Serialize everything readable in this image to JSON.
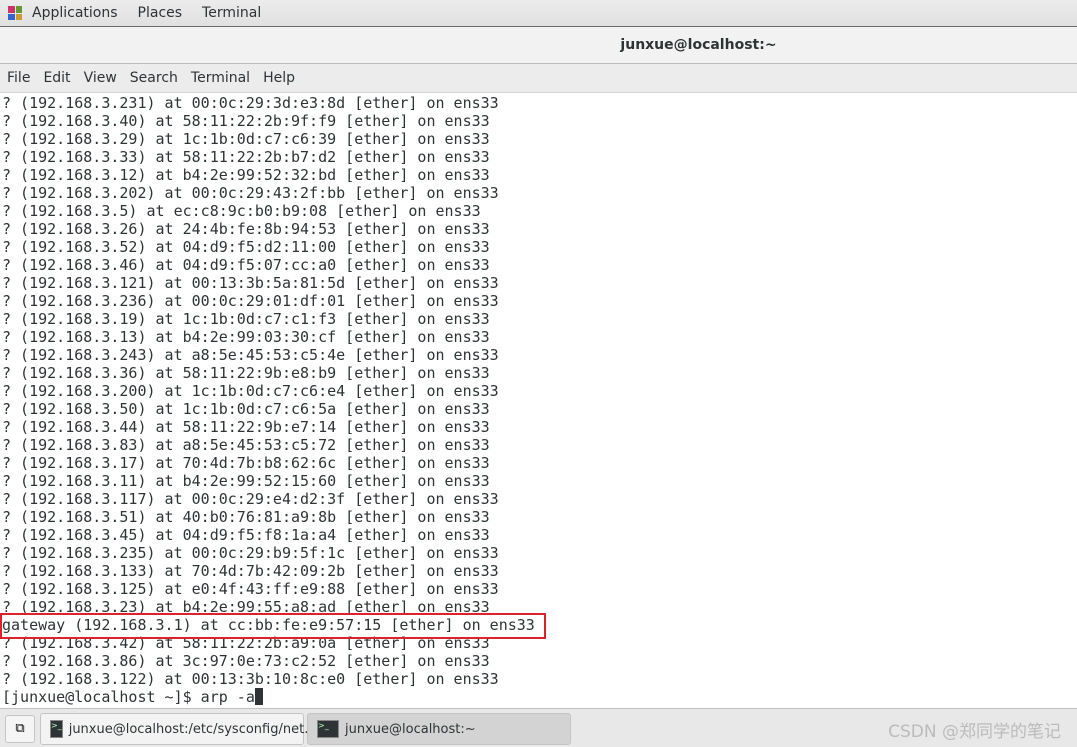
{
  "top_panel": {
    "items": [
      "Applications",
      "Places",
      "Terminal"
    ]
  },
  "window": {
    "title": "junxue@localhost:~"
  },
  "menu": [
    "File",
    "Edit",
    "View",
    "Search",
    "Terminal",
    "Help"
  ],
  "terminal": {
    "lines": [
      "? (192.168.3.231) at 00:0c:29:3d:e3:8d [ether] on ens33",
      "? (192.168.3.40) at 58:11:22:2b:9f:f9 [ether] on ens33",
      "? (192.168.3.29) at 1c:1b:0d:c7:c6:39 [ether] on ens33",
      "? (192.168.3.33) at 58:11:22:2b:b7:d2 [ether] on ens33",
      "? (192.168.3.12) at b4:2e:99:52:32:bd [ether] on ens33",
      "? (192.168.3.202) at 00:0c:29:43:2f:bb [ether] on ens33",
      "? (192.168.3.5) at ec:c8:9c:b0:b9:08 [ether] on ens33",
      "? (192.168.3.26) at 24:4b:fe:8b:94:53 [ether] on ens33",
      "? (192.168.3.52) at 04:d9:f5:d2:11:00 [ether] on ens33",
      "? (192.168.3.46) at 04:d9:f5:07:cc:a0 [ether] on ens33",
      "? (192.168.3.121) at 00:13:3b:5a:81:5d [ether] on ens33",
      "? (192.168.3.236) at 00:0c:29:01:df:01 [ether] on ens33",
      "? (192.168.3.19) at 1c:1b:0d:c7:c1:f3 [ether] on ens33",
      "? (192.168.3.13) at b4:2e:99:03:30:cf [ether] on ens33",
      "? (192.168.3.243) at a8:5e:45:53:c5:4e [ether] on ens33",
      "? (192.168.3.36) at 58:11:22:9b:e8:b9 [ether] on ens33",
      "? (192.168.3.200) at 1c:1b:0d:c7:c6:e4 [ether] on ens33",
      "? (192.168.3.50) at 1c:1b:0d:c7:c6:5a [ether] on ens33",
      "? (192.168.3.44) at 58:11:22:9b:e7:14 [ether] on ens33",
      "? (192.168.3.83) at a8:5e:45:53:c5:72 [ether] on ens33",
      "? (192.168.3.17) at 70:4d:7b:b8:62:6c [ether] on ens33",
      "? (192.168.3.11) at b4:2e:99:52:15:60 [ether] on ens33",
      "? (192.168.3.117) at 00:0c:29:e4:d2:3f [ether] on ens33",
      "? (192.168.3.51) at 40:b0:76:81:a9:8b [ether] on ens33",
      "? (192.168.3.45) at 04:d9:f5:f8:1a:a4 [ether] on ens33",
      "? (192.168.3.235) at 00:0c:29:b9:5f:1c [ether] on ens33",
      "? (192.168.3.133) at 70:4d:7b:42:09:2b [ether] on ens33",
      "? (192.168.3.125) at e0:4f:43:ff:e9:88 [ether] on ens33",
      "? (192.168.3.23) at b4:2e:99:55:a8:ad [ether] on ens33",
      "gateway (192.168.3.1) at cc:bb:fe:e9:57:15 [ether] on ens33",
      "? (192.168.3.42) at 58:11:22:2b:a9:0a [ether] on ens33",
      "? (192.168.3.86) at 3c:97:0e:73:c2:52 [ether] on ens33",
      "? (192.168.3.122) at 00:13:3b:10:8c:e0 [ether] on ens33"
    ],
    "prompt": "[junxue@localhost ~]$ arp -a",
    "highlight_color": "#e0202a"
  },
  "taskbar": {
    "tasks": [
      "junxue@localhost:/etc/sysconfig/net...",
      "junxue@localhost:~"
    ]
  },
  "watermark": "CSDN @郑同学的笔记"
}
